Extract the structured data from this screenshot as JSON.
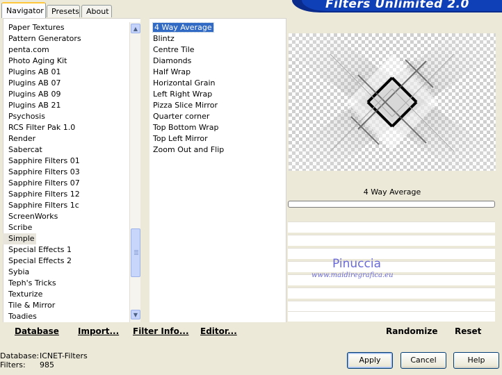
{
  "tabs": [
    "Navigator",
    "Presets",
    "About"
  ],
  "app_title": "Filters Unlimited 2.0",
  "categories": [
    "Paper Textures",
    "Pattern Generators",
    "penta.com",
    "Photo Aging Kit",
    "Plugins AB 01",
    "Plugins AB 07",
    "Plugins AB 09",
    "Plugins AB 21",
    "Psychosis",
    "RCS Filter Pak 1.0",
    "Render",
    "Sabercat",
    "Sapphire Filters 01",
    "Sapphire Filters 03",
    "Sapphire Filters 07",
    "Sapphire Filters 12",
    "Sapphire Filters 1c",
    "ScreenWorks",
    "Scribe",
    "Simple",
    "Special Effects 1",
    "Special Effects 2",
    "Sybia",
    "Teph's Tricks",
    "Texturize",
    "Tile & Mirror",
    "Toadies"
  ],
  "selected_category": "Simple",
  "filters": [
    "4 Way Average",
    "Blintz",
    "Centre Tile",
    "Diamonds",
    "Half Wrap",
    "Horizontal Grain",
    "Left Right Wrap",
    "Pizza Slice Mirror",
    "Quarter corner",
    "Top Bottom Wrap",
    "Top Left Mirror",
    "Zoom Out and Flip"
  ],
  "selected_filter": "4 Way Average",
  "current_filter_label": "4 Way Average",
  "watermark": {
    "name": "Pinuccia",
    "url": "www.maidiregrafica.eu"
  },
  "links": {
    "database": "Database",
    "import": "Import...",
    "filter_info": "Filter Info...",
    "editor": "Editor...",
    "randomize": "Randomize",
    "reset": "Reset"
  },
  "status": {
    "database_label": "Database:",
    "database_value": "ICNET-Filters",
    "filters_label": "Filters:",
    "filters_value": "985"
  },
  "buttons": {
    "apply": "Apply",
    "cancel": "Cancel",
    "help": "Help"
  },
  "colors": {
    "selection": "#316ac5",
    "banner": "#0a2a8c",
    "face": "#ece9d8"
  }
}
